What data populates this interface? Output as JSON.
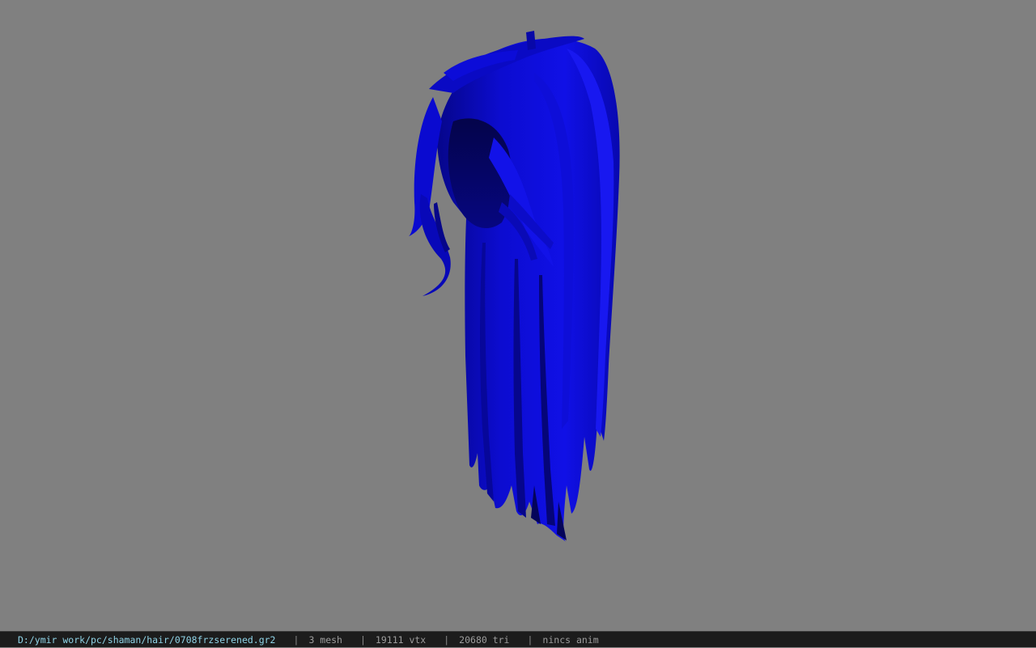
{
  "viewport": {
    "background_color": "#808080",
    "model_name": "hair-mesh",
    "model_color": "#0a0ad8",
    "model_shadow_color": "#050568"
  },
  "statusbar": {
    "file_path": "D:/ymir work/pc/shaman/hair/0708frzserened.gr2",
    "separator": "|",
    "mesh_count": "3 mesh",
    "vertex_count": "19111 vtx",
    "triangle_count": "20680 tri",
    "anim_status": "nincs anim",
    "path_color": "#8fd3e6",
    "text_color": "#9c9c9c"
  }
}
